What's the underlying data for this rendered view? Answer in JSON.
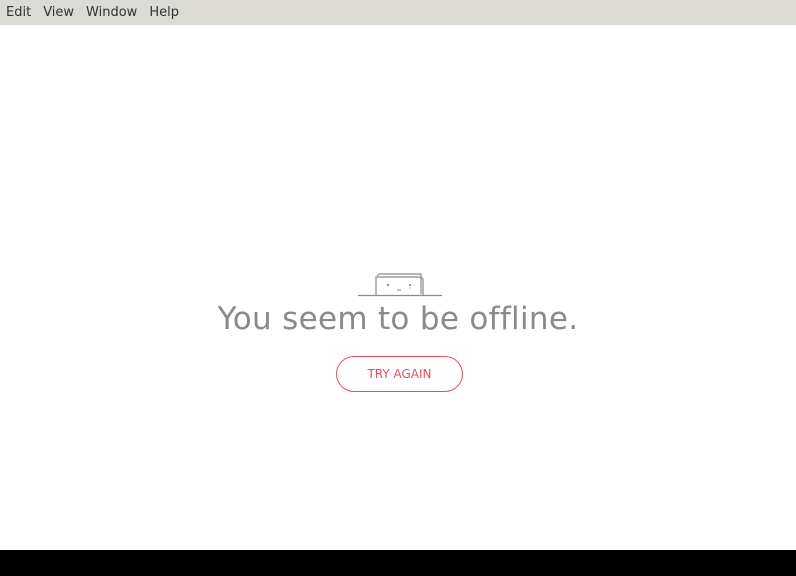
{
  "menubar": {
    "items": [
      {
        "label": "Edit"
      },
      {
        "label": "View"
      },
      {
        "label": "Window"
      },
      {
        "label": "Help"
      }
    ]
  },
  "main": {
    "illustration_icon": "offline-laptop-face-icon",
    "message": "You seem to be offline.",
    "retry_label": "TRY AGAIN"
  },
  "colors": {
    "menubar_bg": "#dcdad5",
    "accent": "#e8505b",
    "message_text": "#8a8a8a"
  }
}
